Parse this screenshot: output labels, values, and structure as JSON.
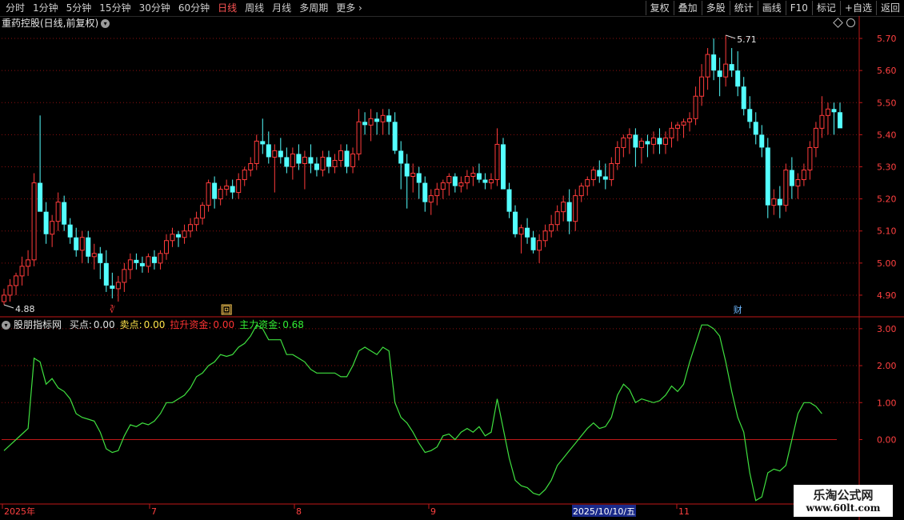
{
  "toolbar": {
    "periods": [
      {
        "label": "分时",
        "active": false
      },
      {
        "label": "1分钟",
        "active": false
      },
      {
        "label": "5分钟",
        "active": false
      },
      {
        "label": "15分钟",
        "active": false
      },
      {
        "label": "30分钟",
        "active": false
      },
      {
        "label": "60分钟",
        "active": false
      },
      {
        "label": "日线",
        "active": true
      },
      {
        "label": "周线",
        "active": false
      },
      {
        "label": "月线",
        "active": false
      },
      {
        "label": "多周期",
        "active": false
      },
      {
        "label": "更多",
        "active": false
      }
    ],
    "more_icon": "chevron-right-icon",
    "buttons": [
      "复权",
      "叠加",
      "多股",
      "统计",
      "画线",
      "F10",
      "标记",
      "+自选",
      "返回"
    ]
  },
  "stock": {
    "title": "重药控股(日线,前复权)"
  },
  "price_axis": {
    "labels": [
      "5.70",
      "5.60",
      "5.50",
      "5.40",
      "5.30",
      "5.20",
      "5.10",
      "5.00",
      "4.90"
    ]
  },
  "markers": {
    "high": "5.71",
    "low": "4.88",
    "events": [
      "∛",
      "回",
      "财"
    ]
  },
  "indicator": {
    "name": "股朋指标网",
    "items": [
      {
        "label": "买点:",
        "value": "0.00",
        "color": "#e0e0e0"
      },
      {
        "label": "卖点:",
        "value": "0.00",
        "color": "#ffe24a"
      },
      {
        "label": "拉升资金:",
        "value": "0.00",
        "color": "#ff3333"
      },
      {
        "label": "主力资金:",
        "value": "0.68",
        "color": "#33ee33"
      }
    ],
    "axis_labels": [
      "3.00",
      "2.00",
      "1.00",
      "0.00"
    ]
  },
  "time_axis": {
    "labels": [
      "2025年",
      "7",
      "8",
      "9",
      "11"
    ],
    "cursor_date": "2025/10/10/五"
  },
  "colors": {
    "up": "#ff3b3b",
    "down": "#54ffff",
    "line": "#3fe03f",
    "grid": "#8b1010",
    "zero": "#c01818"
  },
  "watermark": {
    "line1": "乐淘公式网",
    "line2": "www.60lt.com"
  },
  "chart_data": {
    "type": "candlestick",
    "title": "重药控股(日线,前复权)",
    "ylim": [
      4.86,
      5.73
    ],
    "candles": [
      [
        4.88,
        4.92,
        4.87,
        4.9
      ],
      [
        4.9,
        4.95,
        4.88,
        4.93
      ],
      [
        4.93,
        4.97,
        4.9,
        4.96
      ],
      [
        4.96,
        5.02,
        4.93,
        4.99
      ],
      [
        4.99,
        5.04,
        4.96,
        5.01
      ],
      [
        5.01,
        5.28,
        4.99,
        5.25
      ],
      [
        5.25,
        5.46,
        5.2,
        5.16
      ],
      [
        5.16,
        5.19,
        5.06,
        5.09
      ],
      [
        5.09,
        5.15,
        5.05,
        5.13
      ],
      [
        5.13,
        5.22,
        5.1,
        5.19
      ],
      [
        5.19,
        5.21,
        5.1,
        5.12
      ],
      [
        5.12,
        5.14,
        5.06,
        5.08
      ],
      [
        5.08,
        5.11,
        5.02,
        5.04
      ],
      [
        5.04,
        5.1,
        5.0,
        5.08
      ],
      [
        5.08,
        5.1,
        5.0,
        5.02
      ],
      [
        5.02,
        5.06,
        4.98,
        5.03
      ],
      [
        5.03,
        5.05,
        4.95,
        5.0
      ],
      [
        5.0,
        5.04,
        4.91,
        4.93
      ],
      [
        4.93,
        4.97,
        4.89,
        4.92
      ],
      [
        4.92,
        4.96,
        4.88,
        4.94
      ],
      [
        4.94,
        5.0,
        4.91,
        4.98
      ],
      [
        4.98,
        5.03,
        4.95,
        5.01
      ],
      [
        5.01,
        5.03,
        4.98,
        5.0
      ],
      [
        5.0,
        5.02,
        4.97,
        4.99
      ],
      [
        4.99,
        5.03,
        4.97,
        5.02
      ],
      [
        5.02,
        5.04,
        4.98,
        5.0
      ],
      [
        5.0,
        5.04,
        4.98,
        5.03
      ],
      [
        5.03,
        5.09,
        5.01,
        5.07
      ],
      [
        5.07,
        5.11,
        5.05,
        5.09
      ],
      [
        5.09,
        5.1,
        5.05,
        5.08
      ],
      [
        5.08,
        5.12,
        5.06,
        5.1
      ],
      [
        5.1,
        5.14,
        5.08,
        5.12
      ],
      [
        5.12,
        5.16,
        5.1,
        5.14
      ],
      [
        5.14,
        5.19,
        5.12,
        5.18
      ],
      [
        5.18,
        5.26,
        5.16,
        5.25
      ],
      [
        5.25,
        5.27,
        5.17,
        5.2
      ],
      [
        5.2,
        5.24,
        5.18,
        5.23
      ],
      [
        5.23,
        5.26,
        5.21,
        5.24
      ],
      [
        5.24,
        5.26,
        5.2,
        5.22
      ],
      [
        5.22,
        5.28,
        5.2,
        5.26
      ],
      [
        5.26,
        5.3,
        5.24,
        5.29
      ],
      [
        5.29,
        5.33,
        5.27,
        5.31
      ],
      [
        5.31,
        5.4,
        5.29,
        5.38
      ],
      [
        5.38,
        5.45,
        5.34,
        5.37
      ],
      [
        5.37,
        5.41,
        5.31,
        5.33
      ],
      [
        5.33,
        5.37,
        5.22,
        5.35
      ],
      [
        5.35,
        5.39,
        5.31,
        5.33
      ],
      [
        5.33,
        5.36,
        5.28,
        5.3
      ],
      [
        5.3,
        5.36,
        5.26,
        5.34
      ],
      [
        5.34,
        5.37,
        5.29,
        5.31
      ],
      [
        5.31,
        5.35,
        5.23,
        5.33
      ],
      [
        5.33,
        5.37,
        5.28,
        5.31
      ],
      [
        5.31,
        5.33,
        5.27,
        5.29
      ],
      [
        5.29,
        5.35,
        5.27,
        5.33
      ],
      [
        5.33,
        5.35,
        5.28,
        5.3
      ],
      [
        5.3,
        5.34,
        5.28,
        5.32
      ],
      [
        5.32,
        5.37,
        5.3,
        5.35
      ],
      [
        5.35,
        5.37,
        5.28,
        5.3
      ],
      [
        5.3,
        5.36,
        5.28,
        5.34
      ],
      [
        5.34,
        5.48,
        5.32,
        5.44
      ],
      [
        5.44,
        5.47,
        5.4,
        5.43
      ],
      [
        5.43,
        5.48,
        5.38,
        5.45
      ],
      [
        5.45,
        5.47,
        5.4,
        5.44
      ],
      [
        5.44,
        5.48,
        5.4,
        5.46
      ],
      [
        5.46,
        5.48,
        5.4,
        5.44
      ],
      [
        5.44,
        5.47,
        5.34,
        5.35
      ],
      [
        5.35,
        5.38,
        5.23,
        5.31
      ],
      [
        5.31,
        5.34,
        5.17,
        5.27
      ],
      [
        5.27,
        5.31,
        5.22,
        5.28
      ],
      [
        5.28,
        5.3,
        5.2,
        5.25
      ],
      [
        5.25,
        5.27,
        5.16,
        5.19
      ],
      [
        5.19,
        5.23,
        5.15,
        5.21
      ],
      [
        5.21,
        5.25,
        5.18,
        5.23
      ],
      [
        5.23,
        5.26,
        5.2,
        5.25
      ],
      [
        5.25,
        5.28,
        5.21,
        5.27
      ],
      [
        5.27,
        5.28,
        5.22,
        5.24
      ],
      [
        5.24,
        5.27,
        5.22,
        5.25
      ],
      [
        5.25,
        5.29,
        5.23,
        5.27
      ],
      [
        5.27,
        5.3,
        5.24,
        5.28
      ],
      [
        5.28,
        5.31,
        5.25,
        5.26
      ],
      [
        5.26,
        5.28,
        5.23,
        5.25
      ],
      [
        5.25,
        5.28,
        5.23,
        5.26
      ],
      [
        5.26,
        5.42,
        5.24,
        5.37
      ],
      [
        5.37,
        5.39,
        5.26,
        5.23
      ],
      [
        5.23,
        5.25,
        5.14,
        5.16
      ],
      [
        5.16,
        5.18,
        5.08,
        5.09
      ],
      [
        5.09,
        5.12,
        5.03,
        5.11
      ],
      [
        5.11,
        5.14,
        5.06,
        5.08
      ],
      [
        5.08,
        5.1,
        5.03,
        5.04
      ],
      [
        5.04,
        5.09,
        5.0,
        5.07
      ],
      [
        5.07,
        5.12,
        5.05,
        5.1
      ],
      [
        5.1,
        5.15,
        5.08,
        5.12
      ],
      [
        5.12,
        5.18,
        5.1,
        5.16
      ],
      [
        5.16,
        5.21,
        5.13,
        5.19
      ],
      [
        5.19,
        5.23,
        5.09,
        5.13
      ],
      [
        5.13,
        5.23,
        5.1,
        5.21
      ],
      [
        5.21,
        5.25,
        5.19,
        5.24
      ],
      [
        5.24,
        5.27,
        5.21,
        5.26
      ],
      [
        5.26,
        5.3,
        5.24,
        5.29
      ],
      [
        5.29,
        5.32,
        5.25,
        5.27
      ],
      [
        5.27,
        5.31,
        5.23,
        5.26
      ],
      [
        5.26,
        5.33,
        5.24,
        5.31
      ],
      [
        5.31,
        5.38,
        5.29,
        5.36
      ],
      [
        5.36,
        5.4,
        5.33,
        5.39
      ],
      [
        5.39,
        5.42,
        5.34,
        5.4
      ],
      [
        5.4,
        5.42,
        5.3,
        5.36
      ],
      [
        5.36,
        5.39,
        5.31,
        5.38
      ],
      [
        5.38,
        5.4,
        5.33,
        5.37
      ],
      [
        5.37,
        5.41,
        5.34,
        5.39
      ],
      [
        5.39,
        5.42,
        5.34,
        5.37
      ],
      [
        5.37,
        5.41,
        5.34,
        5.39
      ],
      [
        5.39,
        5.44,
        5.36,
        5.42
      ],
      [
        5.42,
        5.44,
        5.38,
        5.43
      ],
      [
        5.43,
        5.45,
        5.39,
        5.44
      ],
      [
        5.44,
        5.47,
        5.41,
        5.45
      ],
      [
        5.45,
        5.55,
        5.43,
        5.52
      ],
      [
        5.52,
        5.62,
        5.49,
        5.58
      ],
      [
        5.58,
        5.67,
        5.54,
        5.65
      ],
      [
        5.65,
        5.7,
        5.57,
        5.6
      ],
      [
        5.6,
        5.64,
        5.52,
        5.58
      ],
      [
        5.58,
        5.71,
        5.55,
        5.62
      ],
      [
        5.62,
        5.67,
        5.58,
        5.6
      ],
      [
        5.6,
        5.66,
        5.52,
        5.55
      ],
      [
        5.55,
        5.58,
        5.46,
        5.48
      ],
      [
        5.48,
        5.52,
        5.42,
        5.44
      ],
      [
        5.44,
        5.47,
        5.37,
        5.4
      ],
      [
        5.4,
        5.43,
        5.33,
        5.36
      ],
      [
        5.36,
        5.39,
        5.14,
        5.18
      ],
      [
        5.18,
        5.23,
        5.15,
        5.2
      ],
      [
        5.2,
        5.24,
        5.14,
        5.18
      ],
      [
        5.18,
        5.31,
        5.16,
        5.29
      ],
      [
        5.29,
        5.33,
        5.2,
        5.24
      ],
      [
        5.24,
        5.28,
        5.2,
        5.26
      ],
      [
        5.26,
        5.31,
        5.24,
        5.29
      ],
      [
        5.29,
        5.38,
        5.26,
        5.36
      ],
      [
        5.36,
        5.44,
        5.33,
        5.42
      ],
      [
        5.42,
        5.52,
        5.39,
        5.46
      ],
      [
        5.46,
        5.5,
        5.4,
        5.48
      ],
      [
        5.48,
        5.5,
        5.4,
        5.47
      ],
      [
        5.47,
        5.5,
        5.43,
        5.42
      ]
    ],
    "indicator_series": {
      "name": "主力资金",
      "ylim": [
        -1.7,
        3.3
      ],
      "values": [
        -0.3,
        -0.15,
        0.0,
        0.15,
        0.3,
        2.2,
        2.1,
        1.5,
        1.65,
        1.4,
        1.3,
        1.1,
        0.7,
        0.6,
        0.55,
        0.5,
        0.2,
        -0.25,
        -0.35,
        -0.3,
        0.1,
        0.4,
        0.35,
        0.45,
        0.4,
        0.5,
        0.7,
        1.0,
        1.0,
        1.1,
        1.2,
        1.4,
        1.7,
        1.8,
        2.0,
        2.1,
        2.3,
        2.25,
        2.3,
        2.5,
        2.6,
        2.8,
        3.1,
        3.0,
        2.7,
        2.7,
        2.7,
        2.3,
        2.3,
        2.2,
        2.1,
        1.9,
        1.8,
        1.8,
        1.8,
        1.8,
        1.7,
        1.7,
        2.0,
        2.4,
        2.5,
        2.4,
        2.3,
        2.5,
        2.4,
        1.0,
        0.6,
        0.45,
        0.2,
        -0.1,
        -0.35,
        -0.3,
        -0.2,
        0.1,
        0.15,
        0.0,
        0.2,
        0.3,
        0.2,
        0.35,
        0.1,
        0.2,
        1.1,
        0.3,
        -0.5,
        -1.1,
        -1.25,
        -1.3,
        -1.45,
        -1.5,
        -1.35,
        -1.1,
        -0.7,
        -0.5,
        -0.3,
        -0.1,
        0.1,
        0.3,
        0.45,
        0.3,
        0.35,
        0.6,
        1.2,
        1.5,
        1.35,
        1.0,
        1.1,
        1.05,
        1.0,
        1.05,
        1.2,
        1.45,
        1.3,
        1.5,
        2.1,
        2.6,
        3.1,
        3.1,
        3.0,
        2.8,
        2.1,
        1.3,
        0.6,
        0.2,
        -0.9,
        -1.65,
        -1.55,
        -0.9,
        -0.8,
        -0.85,
        -0.7,
        0.0,
        0.7,
        1.0,
        1.0,
        0.9,
        0.7
      ]
    }
  }
}
